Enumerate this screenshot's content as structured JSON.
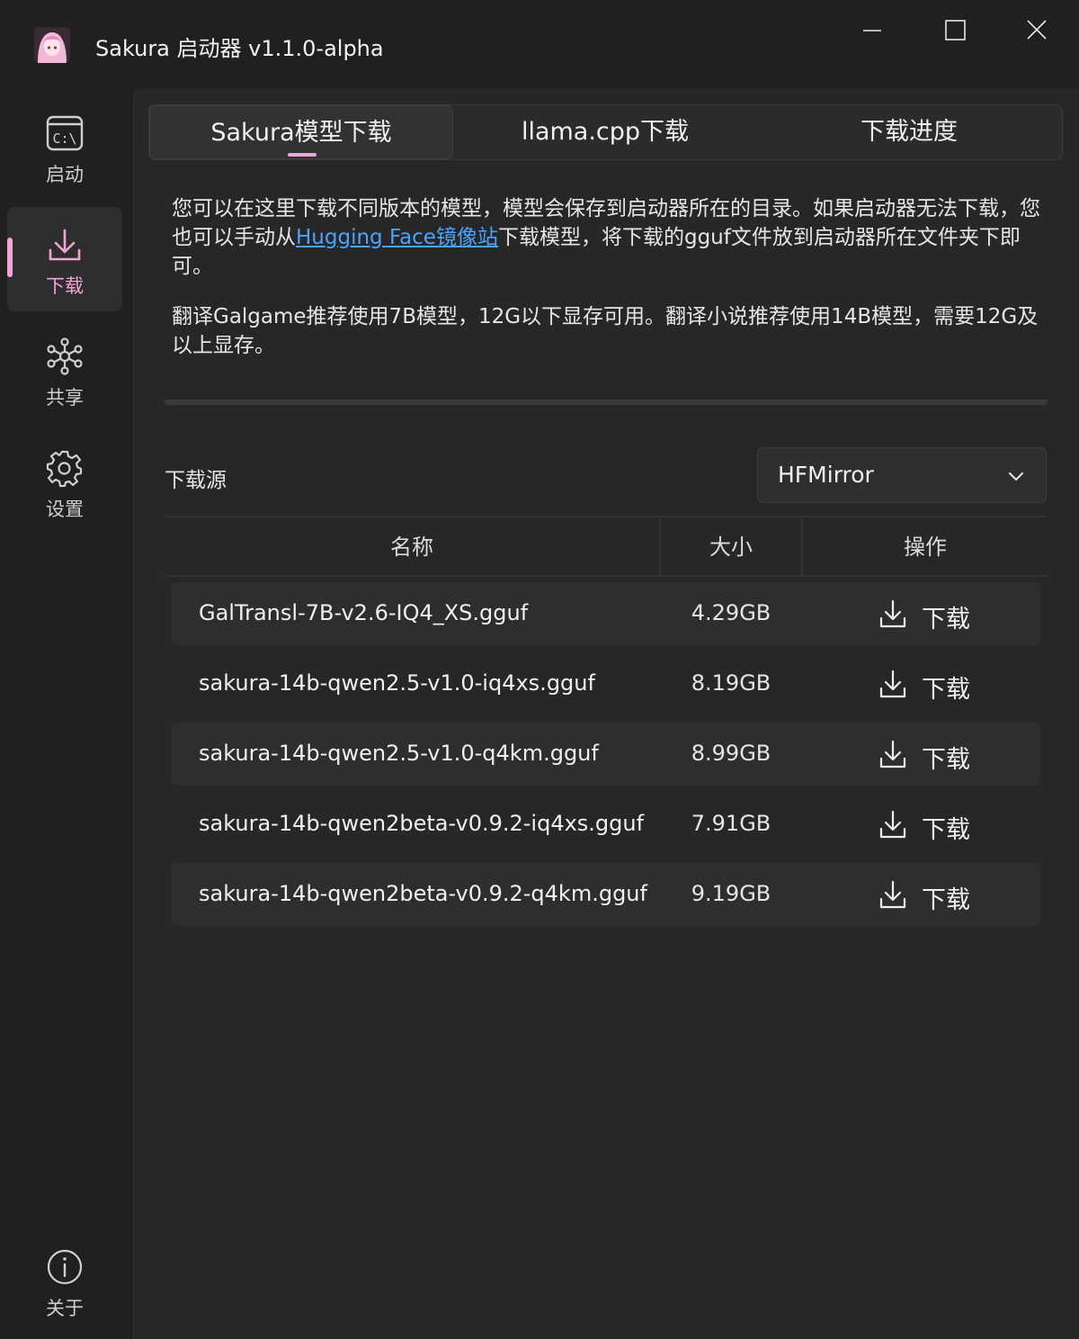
{
  "window": {
    "title": "Sakura 启动器 v1.1.0-alpha"
  },
  "sidebar": {
    "items": [
      {
        "label": "启动",
        "icon": "terminal-icon"
      },
      {
        "label": "下载",
        "icon": "download-icon"
      },
      {
        "label": "共享",
        "icon": "network-icon"
      },
      {
        "label": "设置",
        "icon": "gear-icon"
      },
      {
        "label": "关于",
        "icon": "info-icon"
      }
    ],
    "active_index": 1
  },
  "tabs": [
    {
      "label": "Sakura模型下载"
    },
    {
      "label": "llama.cpp下载"
    },
    {
      "label": "下载进度"
    }
  ],
  "description": {
    "p1_before": "您可以在这里下载不同版本的模型，模型会保存到启动器所在的目录。如果启动器无法下载，您也可以手动从",
    "p1_link": "Hugging Face镜像站",
    "p1_after": "下载模型，将下载的gguf文件放到启动器所在文件夹下即可。",
    "p2": "翻译Galgame推荐使用7B模型，12G以下显存可用。翻译小说推荐使用14B模型，需要12G及以上显存。"
  },
  "source": {
    "label": "下载源",
    "selected": "HFMirror"
  },
  "table": {
    "headers": [
      "名称",
      "大小",
      "操作"
    ],
    "rows": [
      {
        "name": "GalTransl-7B-v2.6-IQ4_XS.gguf",
        "size": "4.29GB",
        "action": "下载"
      },
      {
        "name": "sakura-14b-qwen2.5-v1.0-iq4xs.gguf",
        "size": "8.19GB",
        "action": "下载"
      },
      {
        "name": "sakura-14b-qwen2.5-v1.0-q4km.gguf",
        "size": "8.99GB",
        "action": "下载"
      },
      {
        "name": "sakura-14b-qwen2beta-v0.9.2-iq4xs.gguf",
        "size": "7.91GB",
        "action": "下载"
      },
      {
        "name": "sakura-14b-qwen2beta-v0.9.2-q4km.gguf",
        "size": "9.19GB",
        "action": "下载"
      }
    ]
  },
  "colors": {
    "accent": "#f4a3d8",
    "link": "#4aa3ff",
    "background": "#202020",
    "panel": "#272727"
  }
}
